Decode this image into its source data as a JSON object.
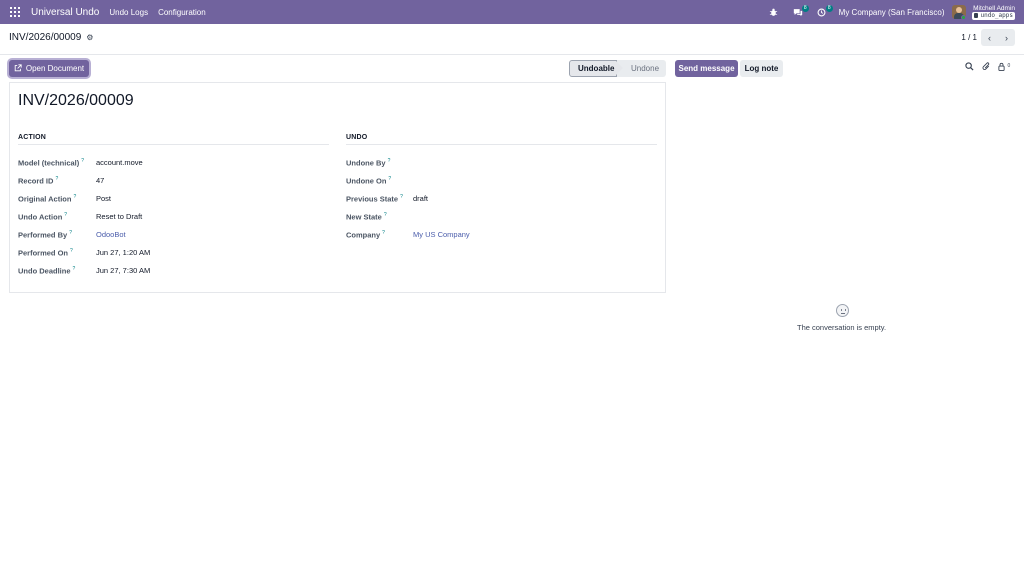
{
  "navbar": {
    "brand": "Universal Undo",
    "menu": [
      "Undo Logs",
      "Configuration"
    ],
    "messages_badge": "8",
    "activities_badge": "8",
    "company": "My Company (San Francisco)",
    "user_name": "Mitchell Admin",
    "database": "undo_apps",
    "accent": "#71639e"
  },
  "control": {
    "breadcrumb": "INV/2026/00009",
    "pager": "1 / 1"
  },
  "actions": {
    "open_document": "Open Document",
    "statuses": [
      {
        "label": "Undoable",
        "active": true
      },
      {
        "label": "Undone",
        "active": false
      }
    ]
  },
  "chatter": {
    "send_message": "Send message",
    "log_note": "Log note",
    "followers_count": "0",
    "empty_text": "The conversation is empty."
  },
  "form": {
    "title": "INV/2026/00009",
    "groups": {
      "action": {
        "title": "ACTION",
        "fields": [
          {
            "label": "Model (technical)",
            "value": "account.move"
          },
          {
            "label": "Record ID",
            "value": "47"
          },
          {
            "label": "Original Action",
            "value": "Post"
          },
          {
            "label": "Undo Action",
            "value": "Reset to Draft"
          },
          {
            "label": "Performed By",
            "value": "OdooBot"
          },
          {
            "label": "Performed On",
            "value": "Jun 27, 1:20 AM"
          },
          {
            "label": "Undo Deadline",
            "value": "Jun 27, 7:30 AM"
          }
        ]
      },
      "undo": {
        "title": "UNDO",
        "fields": [
          {
            "label": "Undone By",
            "value": ""
          },
          {
            "label": "Undone On",
            "value": ""
          },
          {
            "label": "Previous State",
            "value": "draft"
          },
          {
            "label": "New State",
            "value": ""
          },
          {
            "label": "Company",
            "value": "My US Company"
          }
        ]
      }
    }
  }
}
